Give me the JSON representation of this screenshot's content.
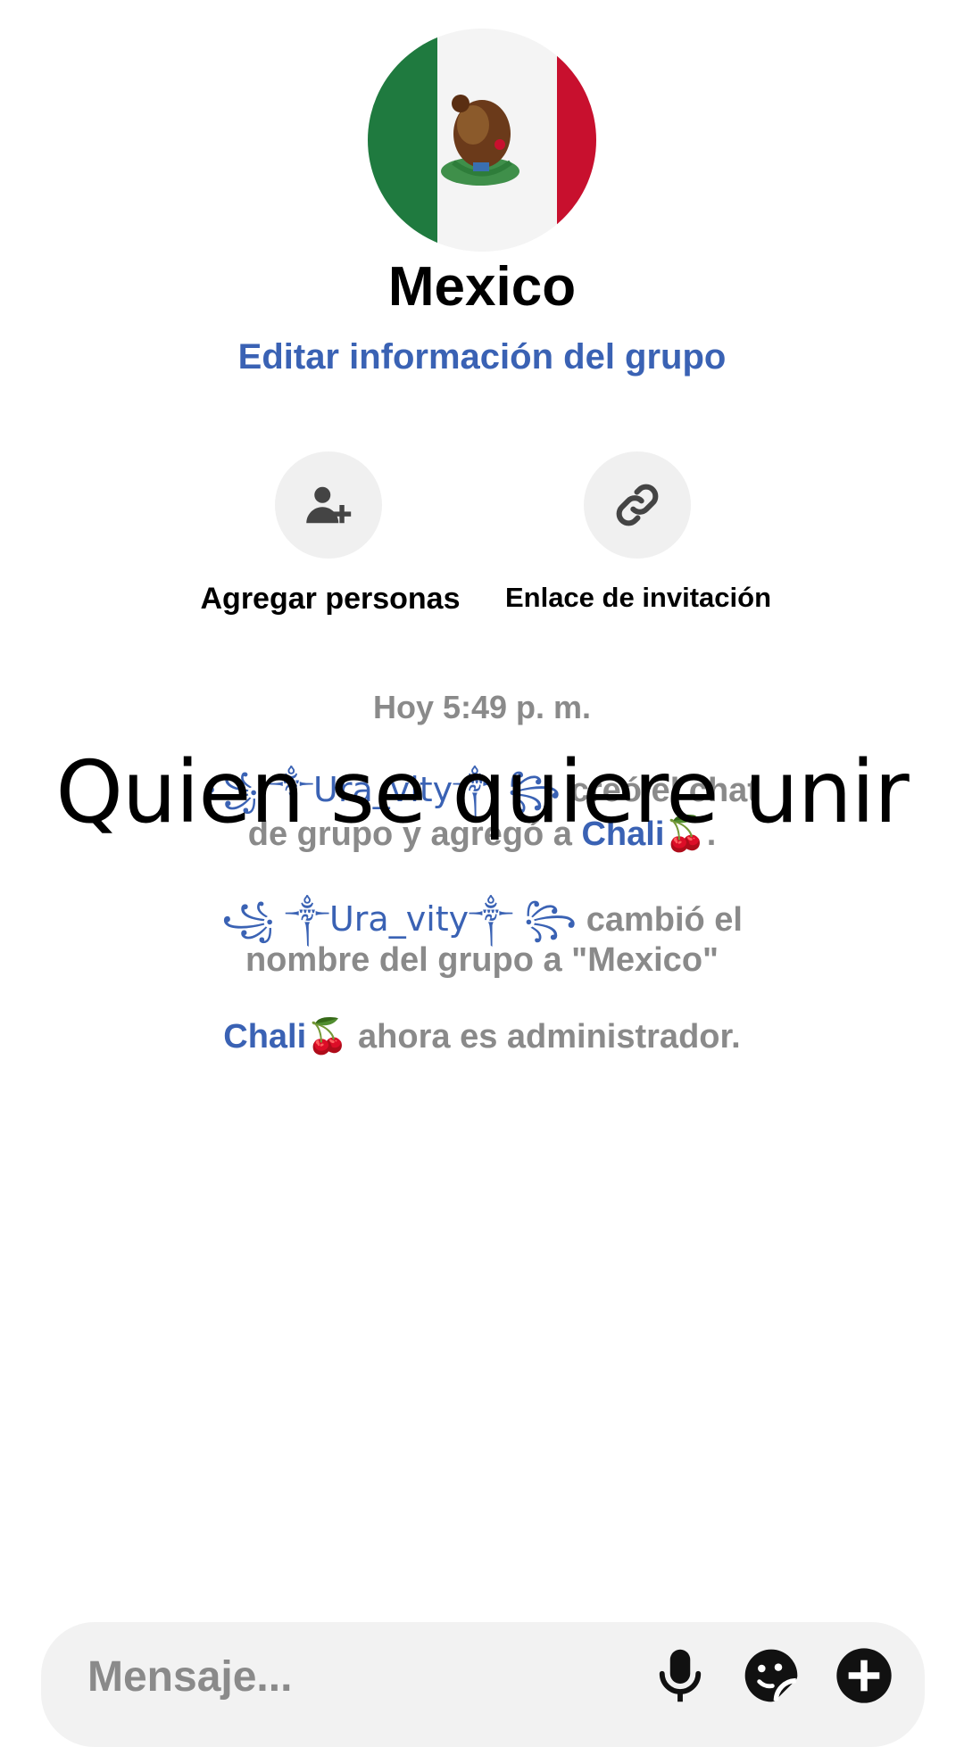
{
  "group": {
    "name": "Mexico",
    "edit_link": "Editar información del grupo"
  },
  "actions": {
    "add_people_label": "Agregar personas",
    "invite_link_label": "Enlace de invitación"
  },
  "timeline": {
    "timestamp": "Hoy 5:49 p. m.",
    "creator_name": "꧁ ༒Ura_vity༒ ꧂",
    "created_text_a": "creó el chat",
    "created_text_b": "de grupo y agregó a",
    "added_user": "Chali🍒",
    "period": ".",
    "renamer_name": "꧁ ༒Ura_vity༒ ꧂",
    "renamed_text_a": "cambió el",
    "renamed_text_b": "nombre del grupo a \"Mexico\"",
    "admin_user": "Chali🍒",
    "admin_text": "ahora es administrador."
  },
  "overlay_caption": "Quien se quiere unir",
  "composer": {
    "placeholder": "Mensaje..."
  },
  "icons": {
    "add_person": "add-person-icon",
    "link": "link-icon",
    "microphone": "microphone-icon",
    "sticker": "sticker-icon",
    "plus": "plus-icon"
  },
  "colors": {
    "accent": "#3a62b4",
    "muted_text": "#8a8a8a",
    "flag_green": "#1f7a3f",
    "flag_red": "#c8102e"
  }
}
